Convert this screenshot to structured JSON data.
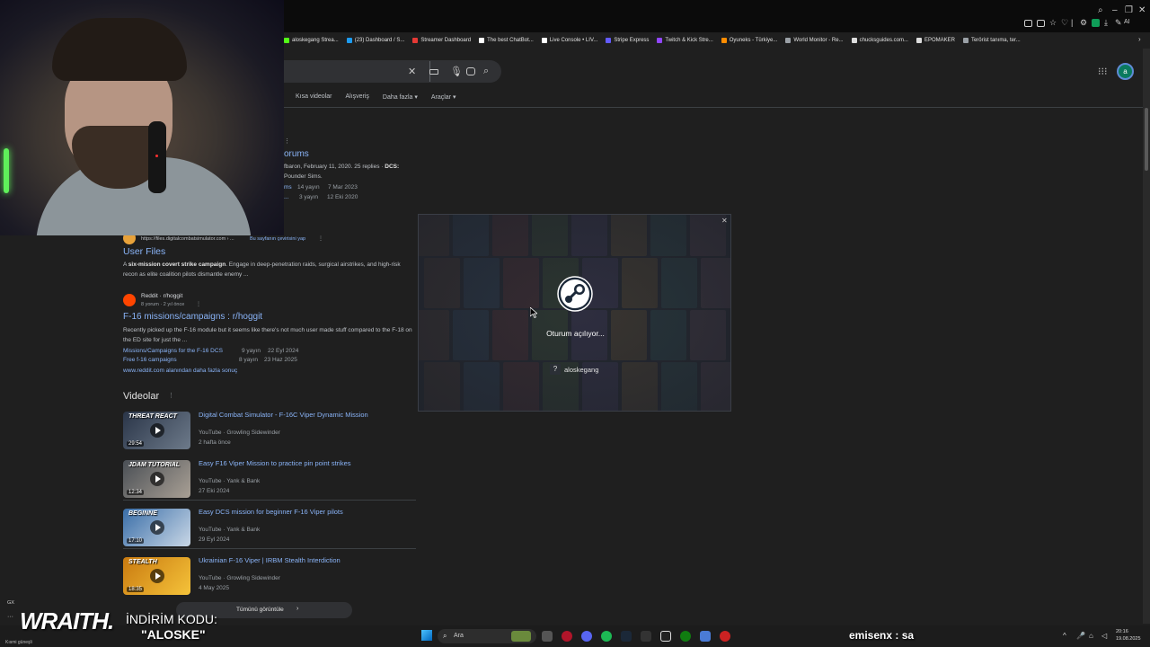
{
  "browser": {
    "bookmarks": [
      {
        "label": "aloskegang Strea...",
        "color": "#53fc18"
      },
      {
        "label": "(23) Dashboard / S...",
        "color": "#1d9bf0"
      },
      {
        "label": "Streamer Dashboard",
        "color": "#e53935"
      },
      {
        "label": "The best ChatBot...",
        "color": "#ffffff"
      },
      {
        "label": "Live Console • LIV...",
        "color": "#ffffff"
      },
      {
        "label": "Stripe Express",
        "color": "#635bff"
      },
      {
        "label": "Twitch & Kick Stre...",
        "color": "#9146ff"
      },
      {
        "label": "Oyuneks - Türkiye...",
        "color": "#ff8c00"
      },
      {
        "label": "World Monitor - Re...",
        "color": "#9aa0a6"
      },
      {
        "label": "chucksguides.com...",
        "color": "#dddddd"
      },
      {
        "label": "EPOMAKER",
        "color": "#dddddd"
      },
      {
        "label": "Terörist tanıma, ter...",
        "color": "#9aa0a6"
      }
    ],
    "ai_label": "AI"
  },
  "google": {
    "tabs": [
      "Kısa videolar",
      "Alışveriş",
      "Daha fazla ▾",
      "Araçlar ▾"
    ],
    "avatar_letter": "a",
    "result_forums": {
      "title_fragment": "orums",
      "meta": "fbaron, February 11, 2020. 25 replies  ·",
      "meta_bold": "DCS:",
      "snippet2": "Pounder Sims.",
      "sub1": {
        "label": "ms",
        "count": "14 yayın",
        "date": "7 Mar 2023"
      },
      "sub2": {
        "label": "...",
        "count": "3 yayın",
        "date": "12 Eki 2020"
      }
    },
    "result_userfiles": {
      "url": "https://files.digitalcombatsimulator.com › ...",
      "translate": "Bu sayfanın çevirisini yap",
      "title": "User Files",
      "snippet_bold": "six-mission covert strike campaign",
      "snippet_pre": "A",
      "snippet_post": ". Engage in deep-penetration raids, surgical airstrikes, and high-risk recon as elite coalition pilots dismantle enemy ..."
    },
    "result_reddit": {
      "site": "Reddit · r/hoggit",
      "meta": "8 yorum · 2 yıl önce",
      "title": "F-16 missions/campaigns : r/hoggit",
      "snippet": "Recently picked up the F-16 module but it seems like there's not much user made stuff compared to the F-18 on the ED site for just the ...",
      "sub1": {
        "label": "Missions/Campaigns for the F-16 DCS",
        "count": "9 yayın",
        "date": "22 Eyl 2024"
      },
      "sub2": {
        "label": "Free f-16 campaigns",
        "count": "8 yayın",
        "date": "23 Haz 2025"
      },
      "more": "www.reddit.com alanından daha fazla sonuç"
    },
    "videos": {
      "heading": "Videolar",
      "items": [
        {
          "title": "Digital Combat Simulator - F-16C Viper Dynamic Mission",
          "channel": "YouTube · Growling Sidewinder",
          "date": "2 hafta önce",
          "duration": "29:54",
          "thumb_text": "THREAT REACT",
          "colors": [
            "#2a3548",
            "#6d7a8a"
          ]
        },
        {
          "title": "Easy F16 Viper Mission to practice pin point strikes",
          "channel": "YouTube · Yank & Bank",
          "date": "27 Eki 2024",
          "duration": "12:34",
          "thumb_text": "JDAM TUTORIAL",
          "colors": [
            "#4a4f55",
            "#a9a095"
          ]
        },
        {
          "title": "Easy DCS mission for beginner F-16 Viper pilots",
          "channel": "YouTube · Yank & Bank",
          "date": "29 Eyl 2024",
          "duration": "17:10",
          "thumb_text": "BEGINNE",
          "colors": [
            "#3a6ea8",
            "#c9d7e6"
          ]
        },
        {
          "title": "Ukrainian F-16 Viper | IRBM Stealth Interdiction",
          "channel": "YouTube · Growling Sidewinder",
          "date": "4 May 2025",
          "duration": "18:35",
          "thumb_text": "STEALTH",
          "colors": [
            "#c97a10",
            "#f5c33a"
          ]
        }
      ],
      "show_all": "Tümünü görüntüle"
    }
  },
  "steam_modal": {
    "status": "Oturum açılıyor...",
    "account": "aloskegang",
    "unknown_avatar": "?"
  },
  "overlay": {
    "brand": "WRAITH.",
    "promo_line1": "İNDİRİM KODU:",
    "promo_line2": "\"ALOSKE\"",
    "chat": "emisenx : sa",
    "corner_label": "GX",
    "weather": "Kısmi güneşli"
  },
  "taskbar": {
    "search_placeholder": "Ara",
    "time": "20:16",
    "date": "19.08.2025"
  }
}
